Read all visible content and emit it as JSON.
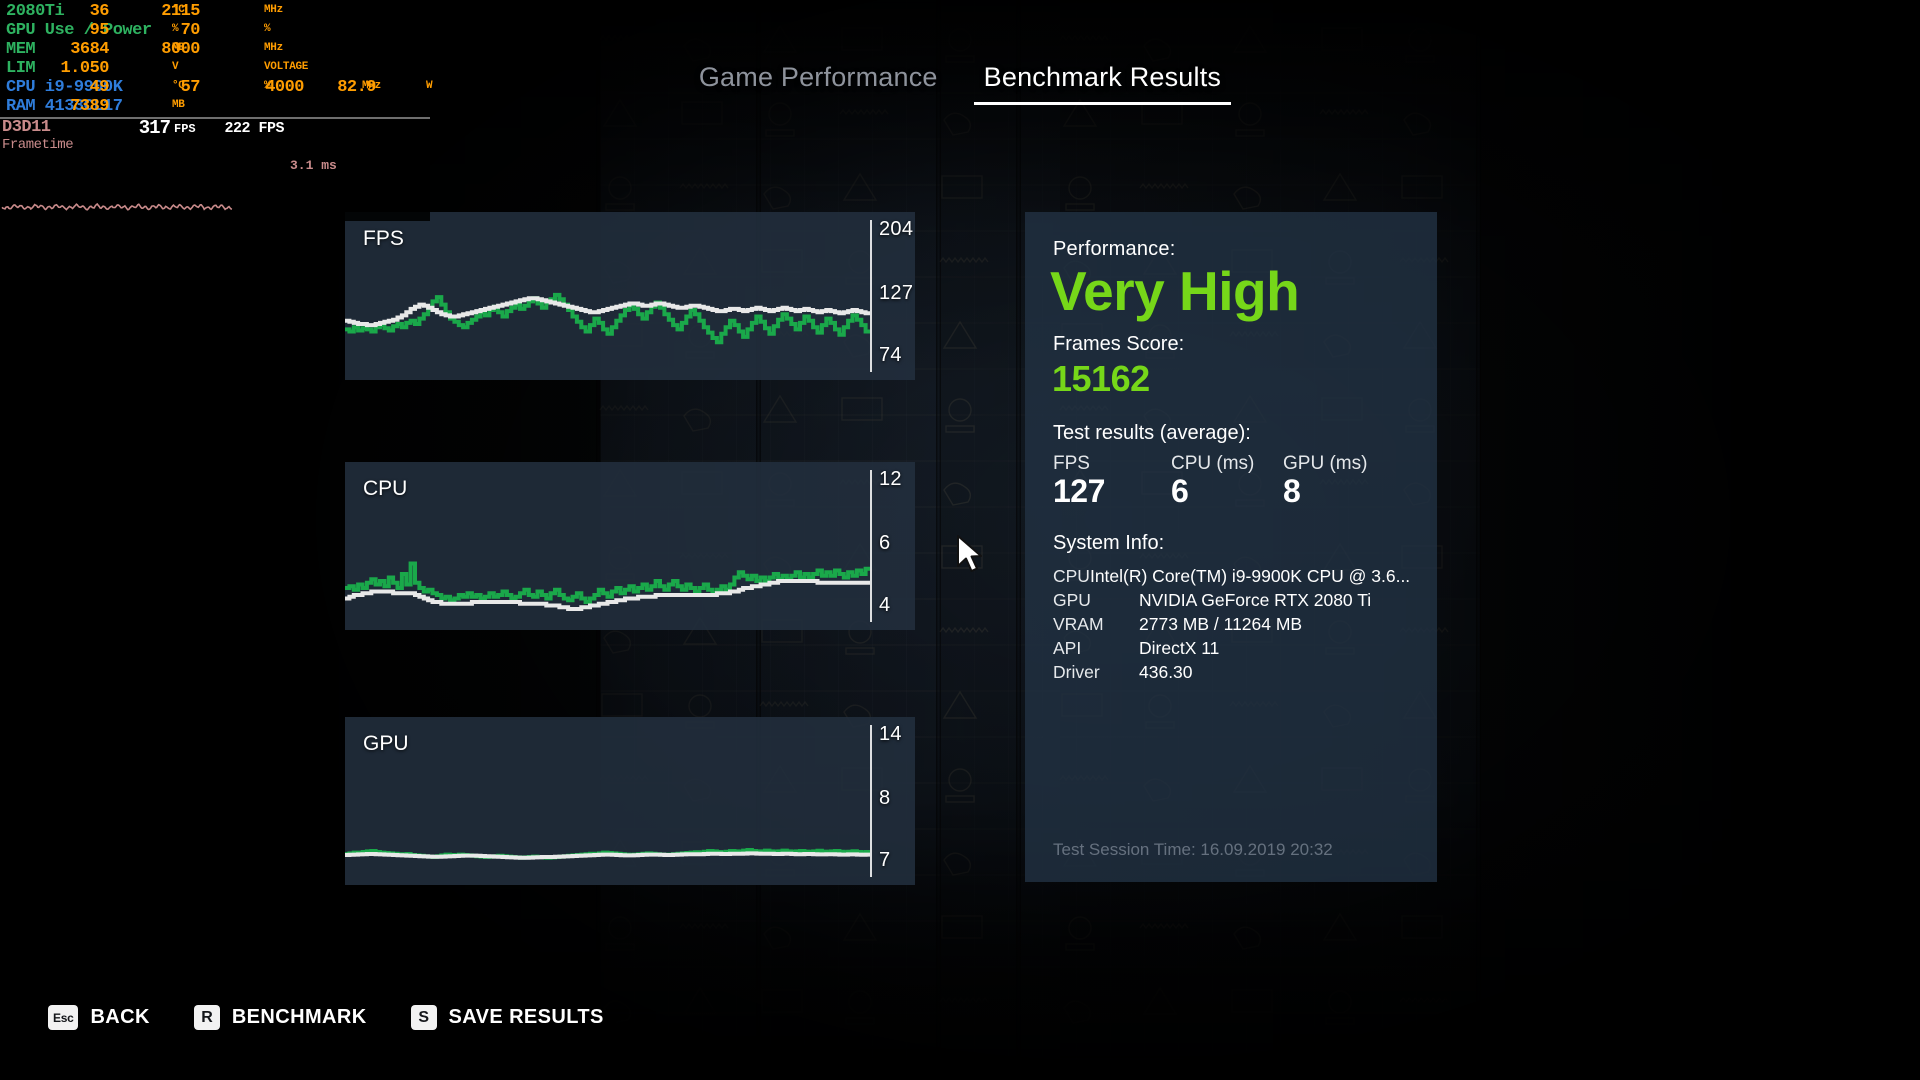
{
  "osd": {
    "rows": [
      {
        "label": "2080Ti",
        "color": "gpu",
        "v1": "36",
        "u1": "°C",
        "v2": "2115",
        "u2": "MHz",
        "v3": "",
        "u3": "",
        "v4": "",
        "u4": ""
      },
      {
        "label": "GPU Use / Power",
        "color": "gpu",
        "v1": "95",
        "u1": "%",
        "v2": "70",
        "u2": "%",
        "v3": "",
        "u3": "",
        "v4": "",
        "u4": ""
      },
      {
        "label": "MEM",
        "color": "gpu",
        "v1": "3684",
        "u1": "MB",
        "v2": "8000",
        "u2": "MHz",
        "v3": "",
        "u3": "",
        "v4": "",
        "u4": ""
      },
      {
        "label": "LIM",
        "color": "gpu",
        "v1": "1.050",
        "u1": "V",
        "v2": "",
        "u2": "VOLTAGE",
        "v3": "",
        "u3": "",
        "v4": "",
        "u4": ""
      },
      {
        "label": "CPU i9-9900K",
        "color": "cpu",
        "v1": "49",
        "u1": "°C",
        "v2": "57",
        "u2": "%",
        "v3": "4000",
        "u3": "MHz",
        "v4": "82.9",
        "u4": "W"
      },
      {
        "label": "RAM 4133CL17",
        "color": "cpu",
        "v1": "7389",
        "u1": "MB",
        "v2": "",
        "u2": "",
        "v3": "",
        "u3": "",
        "v4": "",
        "u4": ""
      }
    ],
    "api_label": "D3D11",
    "fps_value": "317",
    "fps_unit": "FPS",
    "fps_avg": "222 FPS",
    "frametime_label": "Frametime",
    "frametime_value": "3.1 ms"
  },
  "tabs": [
    {
      "label": "Game Performance",
      "active": false
    },
    {
      "label": "Benchmark Results",
      "active": true
    }
  ],
  "chart_data": [
    {
      "type": "line",
      "title": "FPS",
      "ylabel": "FPS",
      "axis_ticks": {
        "max": "204",
        "mid": "127",
        "min": "74"
      },
      "ylim": [
        74,
        204
      ],
      "grid": false,
      "legend": "none",
      "series": [
        {
          "name": "current",
          "color": "#1aa84a",
          "values": [
            108,
            106,
            110,
            107,
            109,
            108,
            106,
            110,
            112,
            109,
            107,
            111,
            113,
            110,
            114,
            116,
            113,
            118,
            122,
            127,
            134,
            138,
            131,
            124,
            118,
            115,
            112,
            110,
            114,
            117,
            120,
            124,
            121,
            126,
            129,
            124,
            120,
            125,
            128,
            131,
            127,
            130,
            134,
            137,
            132,
            128,
            133,
            136,
            140,
            136,
            131,
            126,
            120,
            115,
            110,
            106,
            112,
            118,
            114,
            108,
            104,
            110,
            116,
            121,
            126,
            130,
            127,
            122,
            118,
            124,
            129,
            133,
            128,
            122,
            117,
            112,
            108,
            114,
            120,
            126,
            122,
            116,
            110,
            105,
            100,
            96,
            104,
            110,
            116,
            112,
            106,
            101,
            108,
            114,
            120,
            115,
            109,
            104,
            111,
            117,
            122,
            118,
            113,
            108,
            114,
            120,
            116,
            110,
            105,
            112,
            118,
            114,
            108,
            103,
            110,
            116,
            121,
            117,
            112,
            106
          ]
        },
        {
          "name": "average",
          "color": "#e8e8e8",
          "values": [
            116,
            115,
            114,
            113,
            113,
            112,
            112,
            113,
            114,
            115,
            116,
            117,
            119,
            121,
            124,
            127,
            129,
            131,
            130,
            128,
            126,
            124,
            122,
            121,
            120,
            120,
            121,
            122,
            123,
            124,
            125,
            126,
            127,
            128,
            129,
            130,
            131,
            132,
            133,
            134,
            135,
            136,
            137,
            137,
            136,
            135,
            134,
            133,
            132,
            131,
            130,
            129,
            128,
            127,
            126,
            125,
            124,
            124,
            125,
            126,
            127,
            128,
            129,
            130,
            131,
            132,
            132,
            131,
            130,
            130,
            131,
            132,
            132,
            131,
            130,
            129,
            128,
            128,
            129,
            130,
            130,
            129,
            128,
            127,
            126,
            125,
            125,
            126,
            127,
            127,
            126,
            125,
            126,
            127,
            128,
            127,
            126,
            125,
            126,
            127,
            128,
            127,
            126,
            125,
            126,
            127,
            126,
            125,
            124,
            125,
            126,
            125,
            124,
            123,
            124,
            125,
            126,
            125,
            124,
            123
          ]
        }
      ]
    },
    {
      "type": "line",
      "title": "CPU",
      "ylabel": "CPU (ms)",
      "axis_ticks": {
        "max": "12",
        "mid": "6",
        "min": "4"
      },
      "ylim": [
        4,
        12
      ],
      "grid": false,
      "legend": "none",
      "series": [
        {
          "name": "current",
          "color": "#1aa84a",
          "values": [
            5.6,
            5.7,
            5.5,
            5.8,
            5.6,
            5.9,
            6.1,
            5.8,
            6.0,
            5.7,
            6.2,
            5.9,
            5.6,
            6.4,
            5.8,
            7.0,
            5.9,
            5.6,
            5.4,
            5.5,
            5.3,
            5.2,
            5.0,
            5.1,
            4.9,
            5.0,
            5.2,
            5.1,
            5.3,
            5.1,
            5.2,
            5.0,
            5.1,
            5.3,
            5.1,
            5.2,
            5.4,
            5.2,
            5.0,
            5.1,
            5.3,
            5.5,
            5.2,
            5.1,
            5.4,
            5.2,
            5.0,
            5.3,
            5.5,
            5.2,
            5.0,
            4.9,
            5.1,
            5.3,
            5.0,
            4.8,
            5.0,
            5.2,
            5.5,
            5.3,
            5.1,
            5.4,
            5.6,
            5.3,
            5.5,
            5.7,
            5.4,
            5.6,
            5.8,
            5.5,
            5.7,
            6.0,
            5.7,
            5.5,
            5.8,
            6.0,
            5.7,
            5.5,
            5.8,
            5.6,
            5.4,
            5.6,
            5.8,
            5.5,
            5.3,
            5.5,
            5.7,
            5.5,
            5.8,
            6.2,
            6.5,
            6.3,
            6.1,
            6.3,
            6.0,
            6.2,
            6.0,
            6.2,
            6.4,
            6.1,
            6.3,
            6.1,
            6.3,
            6.5,
            6.2,
            6.4,
            6.2,
            6.4,
            6.6,
            6.3,
            6.5,
            6.3,
            6.6,
            6.4,
            6.2,
            6.5,
            6.3,
            6.6,
            6.4,
            6.7
          ]
        },
        {
          "name": "average",
          "color": "#e8e8e8",
          "values": [
            5.0,
            5.1,
            5.2,
            5.2,
            5.3,
            5.3,
            5.4,
            5.4,
            5.4,
            5.4,
            5.4,
            5.3,
            5.3,
            5.3,
            5.3,
            5.3,
            5.2,
            5.1,
            5.0,
            4.9,
            4.8,
            4.8,
            4.7,
            4.7,
            4.7,
            4.7,
            4.7,
            4.7,
            4.7,
            4.8,
            4.8,
            4.8,
            4.8,
            4.8,
            4.8,
            4.8,
            4.8,
            4.8,
            4.8,
            4.8,
            4.7,
            4.7,
            4.7,
            4.7,
            4.7,
            4.7,
            4.6,
            4.6,
            4.6,
            4.5,
            4.5,
            4.4,
            4.4,
            4.4,
            4.5,
            4.5,
            4.6,
            4.6,
            4.7,
            4.7,
            4.8,
            4.8,
            4.9,
            4.9,
            5.0,
            5.0,
            5.0,
            5.1,
            5.1,
            5.1,
            5.1,
            5.2,
            5.2,
            5.2,
            5.2,
            5.2,
            5.2,
            5.2,
            5.2,
            5.2,
            5.2,
            5.2,
            5.2,
            5.2,
            5.2,
            5.3,
            5.3,
            5.3,
            5.4,
            5.4,
            5.5,
            5.6,
            5.6,
            5.7,
            5.7,
            5.8,
            5.8,
            5.9,
            5.9,
            6.0,
            6.0,
            6.0,
            6.0,
            6.0,
            6.0,
            6.0,
            6.0,
            6.0,
            5.9,
            5.9,
            5.9,
            5.9,
            5.9,
            5.9,
            5.9,
            5.9,
            5.9,
            5.9,
            5.9,
            5.9
          ]
        }
      ]
    },
    {
      "type": "line",
      "title": "GPU",
      "ylabel": "GPU (ms)",
      "axis_ticks": {
        "max": "14",
        "mid": "8",
        "min": "7"
      },
      "ylim": [
        7,
        14
      ],
      "grid": false,
      "legend": "none",
      "series": [
        {
          "name": "current",
          "color": "#1aa84a",
          "values": [
            7.85,
            7.88,
            7.92,
            7.9,
            7.95,
            7.98,
            8.0,
            7.95,
            7.92,
            7.9,
            7.88,
            7.86,
            7.84,
            7.82,
            7.85,
            7.8,
            7.78,
            7.76,
            7.74,
            7.72,
            7.7,
            7.74,
            7.78,
            7.82,
            7.8,
            7.78,
            7.82,
            7.8,
            7.78,
            7.76,
            7.74,
            7.72,
            7.7,
            7.72,
            7.74,
            7.76,
            7.74,
            7.72,
            7.7,
            7.68,
            7.66,
            7.68,
            7.7,
            7.72,
            7.7,
            7.68,
            7.66,
            7.68,
            7.7,
            7.72,
            7.74,
            7.76,
            7.78,
            7.8,
            7.82,
            7.84,
            7.86,
            7.84,
            7.88,
            7.92,
            7.9,
            7.88,
            7.86,
            7.84,
            7.82,
            7.8,
            7.82,
            7.84,
            7.86,
            7.88,
            7.86,
            7.84,
            7.82,
            7.8,
            7.82,
            7.84,
            7.86,
            7.88,
            7.9,
            7.92,
            7.94,
            7.92,
            7.96,
            8.0,
            7.98,
            7.95,
            7.92,
            7.96,
            8.0,
            7.98,
            7.96,
            8.02,
            8.05,
            8.0,
            7.96,
            7.98,
            8.02,
            7.98,
            7.94,
            7.98,
            8.02,
            7.98,
            7.95,
            7.98,
            8.0,
            7.97,
            7.94,
            7.98,
            8.01,
            7.97,
            7.94,
            7.98,
            8.0,
            7.96,
            7.93,
            7.96,
            7.99,
            7.95,
            7.92,
            7.95
          ]
        },
        {
          "name": "average",
          "color": "#e8e8e8",
          "values": [
            7.8,
            7.81,
            7.82,
            7.83,
            7.84,
            7.85,
            7.85,
            7.84,
            7.83,
            7.82,
            7.81,
            7.8,
            7.79,
            7.78,
            7.77,
            7.76,
            7.75,
            7.74,
            7.73,
            7.72,
            7.71,
            7.71,
            7.72,
            7.73,
            7.74,
            7.75,
            7.76,
            7.77,
            7.77,
            7.77,
            7.76,
            7.75,
            7.74,
            7.73,
            7.72,
            7.71,
            7.7,
            7.69,
            7.68,
            7.67,
            7.66,
            7.66,
            7.67,
            7.68,
            7.69,
            7.7,
            7.7,
            7.7,
            7.71,
            7.72,
            7.73,
            7.74,
            7.75,
            7.76,
            7.77,
            7.78,
            7.79,
            7.8,
            7.81,
            7.82,
            7.82,
            7.81,
            7.8,
            7.79,
            7.78,
            7.78,
            7.79,
            7.8,
            7.81,
            7.82,
            7.82,
            7.82,
            7.81,
            7.8,
            7.8,
            7.81,
            7.82,
            7.83,
            7.84,
            7.84,
            7.84,
            7.84,
            7.85,
            7.86,
            7.86,
            7.86,
            7.85,
            7.85,
            7.86,
            7.86,
            7.86,
            7.87,
            7.88,
            7.88,
            7.87,
            7.86,
            7.86,
            7.86,
            7.85,
            7.85,
            7.86,
            7.86,
            7.85,
            7.84,
            7.84,
            7.85,
            7.85,
            7.84,
            7.83,
            7.83,
            7.84,
            7.84,
            7.83,
            7.82,
            7.82,
            7.83,
            7.83,
            7.82,
            7.81,
            7.82
          ]
        }
      ]
    }
  ],
  "results": {
    "performance_label": "Performance:",
    "performance_value": "Very High",
    "frames_score_label": "Frames Score:",
    "frames_score_value": "15162",
    "test_results_label": "Test results (average):",
    "test_results": [
      {
        "name": "FPS",
        "value": "127"
      },
      {
        "name": "CPU (ms)",
        "value": "6"
      },
      {
        "name": "GPU (ms)",
        "value": "8"
      }
    ],
    "system_info_label": "System Info:",
    "system_info": [
      {
        "key": "CPU",
        "value": "Intel(R) Core(TM) i9-9900K CPU @ 3.6..."
      },
      {
        "key": "GPU",
        "value": "NVIDIA GeForce RTX 2080 Ti"
      },
      {
        "key": "VRAM",
        "value": "2773 MB / 11264 MB"
      },
      {
        "key": "API",
        "value": "DirectX 11"
      },
      {
        "key": "Driver",
        "value": "436.30"
      }
    ],
    "session_time": "Test Session Time: 16.09.2019 20:32",
    "accent_green": "#76d719"
  },
  "keybinds": [
    {
      "key": "Esc",
      "label": "BACK"
    },
    {
      "key": "R",
      "label": "BENCHMARK"
    },
    {
      "key": "S",
      "label": "SAVE RESULTS"
    }
  ]
}
